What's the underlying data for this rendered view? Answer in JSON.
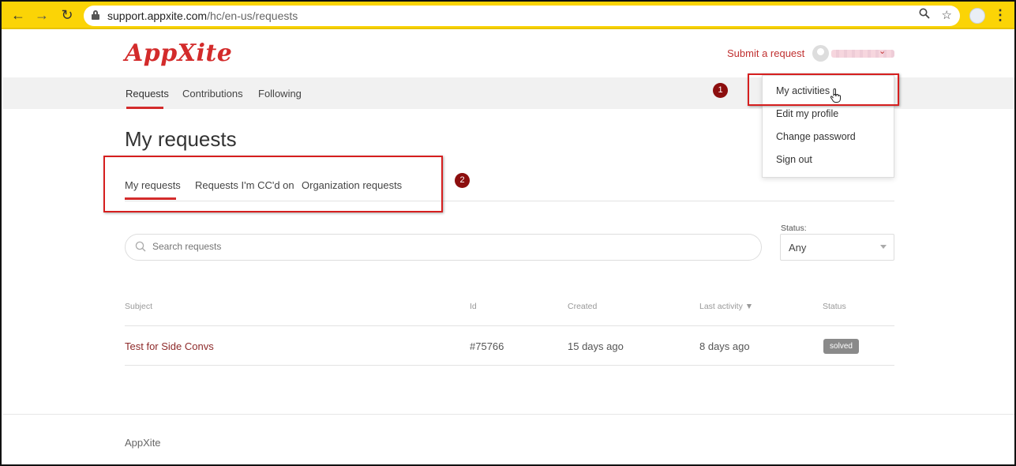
{
  "browser": {
    "url_host": "support.appxite.com",
    "url_path": "/hc/en-us/requests"
  },
  "header": {
    "logo_text": "AppXite",
    "submit_request": "Submit a request"
  },
  "nav": {
    "items": [
      "Requests",
      "Contributions",
      "Following"
    ]
  },
  "user_menu": {
    "items": [
      "My activities",
      "Edit my profile",
      "Change password",
      "Sign out"
    ]
  },
  "annotations": {
    "badge1": "1",
    "badge2": "2"
  },
  "main": {
    "title": "My requests",
    "tabs": [
      "My requests",
      "Requests I'm CC'd on",
      "Organization requests"
    ],
    "search_placeholder": "Search requests",
    "status_label": "Status:",
    "status_value": "Any"
  },
  "table": {
    "headers": [
      "Subject",
      "Id",
      "Created",
      "Last activity ▼",
      "Status"
    ],
    "rows": [
      {
        "subject": "Test for Side Convs",
        "id": "#75766",
        "created": "15 days ago",
        "last_activity": "8 days ago",
        "status": "solved"
      }
    ]
  },
  "footer": {
    "text": "AppXite"
  },
  "colors": {
    "chrome": "#fbd406",
    "brand_red": "#d32b2b",
    "highlight_box": "#d61f1f",
    "badge": "#8c0e0e"
  }
}
